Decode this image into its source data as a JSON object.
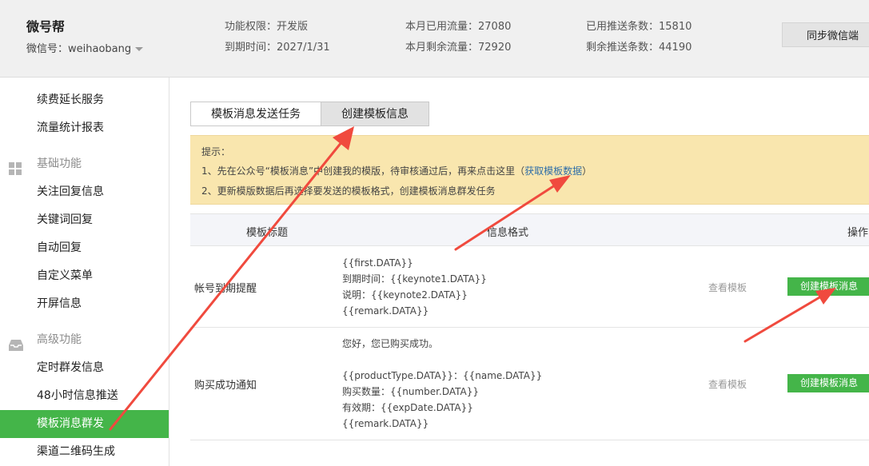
{
  "header": {
    "brand": "微号帮",
    "account": "微信号：weihaobang",
    "stats": {
      "permission": "功能权限：开发版",
      "expire": "到期时间：2027/1/31",
      "used_traffic": "本月已用流量：27080",
      "remaining_traffic": "本月剩余流量：72920",
      "used_push": "已用推送条数：15810",
      "remaining_push": "剩余推送条数：44190"
    },
    "sync_label": "同步微信端"
  },
  "sidebar": {
    "items_top": [
      "续费延长服务",
      "流量统计报表"
    ],
    "section_basic": "基础功能",
    "items_basic": [
      "关注回复信息",
      "关键词回复",
      "自动回复",
      "自定义菜单",
      "开屏信息"
    ],
    "section_advanced": "高级功能",
    "items_advanced": [
      "定时群发信息",
      "48小时信息推送",
      "模板消息群发",
      "渠道二维码生成"
    ],
    "active": "模板消息群发"
  },
  "tabs": [
    "模板消息发送任务",
    "创建模板信息"
  ],
  "notice": {
    "title": "提示：",
    "line1_pre": "1、先在公众号“模板消息”中创建我的模版，待审核通过后，再来点击这里（",
    "line1_link": "获取模板数据",
    "line1_post": "）",
    "line2": "2、更新模版数据后再选择要发送的模板格式，创建模板消息群发任务"
  },
  "table": {
    "headers": [
      "模板标题",
      "信息格式",
      "操作"
    ],
    "rows": [
      {
        "title": "帐号到期提醒",
        "format": [
          "{{first.DATA}}",
          "到期时间：{{keynote1.DATA}}",
          "说明：{{keynote2.DATA}}",
          "{{remark.DATA}}"
        ],
        "view_label": "查看模板",
        "create_label": "创建模板消息"
      },
      {
        "title": "购买成功通知",
        "format": [
          "您好，您已购买成功。",
          "",
          "{{productType.DATA}}：{{name.DATA}}",
          "购买数量：{{number.DATA}}",
          "有效期：{{expDate.DATA}}",
          "{{remark.DATA}}"
        ],
        "view_label": "查看模板",
        "create_label": "创建模板消息"
      }
    ]
  },
  "colors": {
    "accent_green": "#44b549",
    "notice_bg": "#f9e6ae",
    "arrow_red": "#f04a3e"
  }
}
